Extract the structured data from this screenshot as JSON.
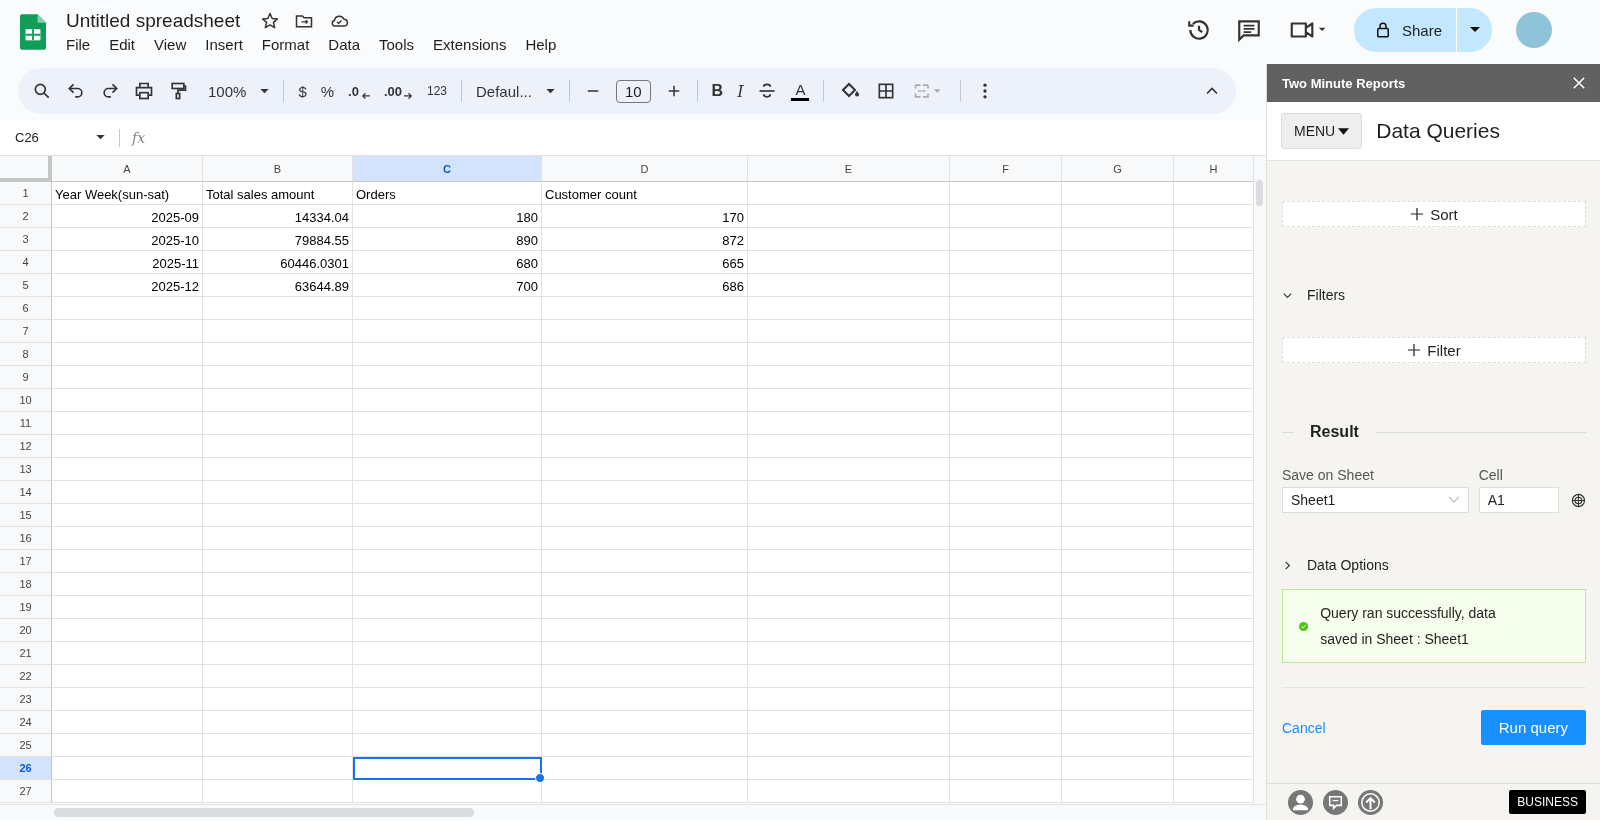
{
  "document": {
    "title": "Untitled spreadsheet"
  },
  "menu": [
    "File",
    "Edit",
    "View",
    "Insert",
    "Format",
    "Data",
    "Tools",
    "Extensions",
    "Help"
  ],
  "share_button": {
    "label": "Share"
  },
  "toolbar": {
    "zoom": "100%",
    "currency": "$",
    "percent": "%",
    "decrease_decimals": ".0",
    "increase_decimals": ".00",
    "number_format": "123",
    "font": "Defaul...",
    "font_size": "10",
    "bold": "B",
    "italic": "I",
    "text_color": "A"
  },
  "name_box": "C26",
  "formula_label": "fx",
  "sheet": {
    "columns": [
      {
        "label": "A",
        "selected": false
      },
      {
        "label": "B",
        "selected": false
      },
      {
        "label": "C",
        "selected": true
      },
      {
        "label": "D",
        "selected": false
      },
      {
        "label": "E",
        "selected": false
      },
      {
        "label": "F",
        "selected": false
      },
      {
        "label": "G",
        "selected": false
      },
      {
        "label": "H",
        "selected": false
      }
    ],
    "rows": [
      {
        "number": "1",
        "selected": false,
        "cells": [
          "Year Week(sun-sat)",
          "Total sales amount",
          "Orders",
          "Customer count"
        ]
      },
      {
        "number": "2",
        "selected": false,
        "cells": [
          "2025-09",
          "14334.04",
          "180",
          "170"
        ]
      },
      {
        "number": "3",
        "selected": false,
        "cells": [
          "2025-10",
          "79884.55",
          "890",
          "872"
        ]
      },
      {
        "number": "4",
        "selected": false,
        "cells": [
          "2025-11",
          "60446.0301",
          "680",
          "665"
        ]
      },
      {
        "number": "5",
        "selected": false,
        "cells": [
          "2025-12",
          "63644.89",
          "700",
          "686"
        ]
      },
      {
        "number": "6",
        "selected": false,
        "cells": []
      },
      {
        "number": "7",
        "selected": false,
        "cells": []
      },
      {
        "number": "8",
        "selected": false,
        "cells": []
      },
      {
        "number": "9",
        "selected": false,
        "cells": []
      },
      {
        "number": "10",
        "selected": false,
        "cells": []
      },
      {
        "number": "11",
        "selected": false,
        "cells": []
      },
      {
        "number": "12",
        "selected": false,
        "cells": []
      },
      {
        "number": "13",
        "selected": false,
        "cells": []
      },
      {
        "number": "14",
        "selected": false,
        "cells": []
      },
      {
        "number": "15",
        "selected": false,
        "cells": []
      },
      {
        "number": "16",
        "selected": false,
        "cells": []
      },
      {
        "number": "17",
        "selected": false,
        "cells": []
      },
      {
        "number": "18",
        "selected": false,
        "cells": []
      },
      {
        "number": "19",
        "selected": false,
        "cells": []
      },
      {
        "number": "20",
        "selected": false,
        "cells": []
      },
      {
        "number": "21",
        "selected": false,
        "cells": []
      },
      {
        "number": "22",
        "selected": false,
        "cells": []
      },
      {
        "number": "23",
        "selected": false,
        "cells": []
      },
      {
        "number": "24",
        "selected": false,
        "cells": []
      },
      {
        "number": "25",
        "selected": false,
        "cells": []
      },
      {
        "number": "26",
        "selected": true,
        "cells": []
      },
      {
        "number": "27",
        "selected": false,
        "cells": []
      }
    ]
  },
  "sidebar": {
    "title": "Two Minute Reports",
    "menu_button": "MENU",
    "heading": "Data Queries",
    "sort_button": "Sort",
    "filters": {
      "label": "Filters",
      "expanded": true,
      "button": "Filter"
    },
    "result": {
      "heading": "Result",
      "sheet_label": "Save on Sheet",
      "sheet_value": "Sheet1",
      "cell_label": "Cell",
      "cell_value": "A1"
    },
    "data_options": {
      "label": "Data Options",
      "expanded": false
    },
    "message": "Query ran successfully, data saved in Sheet : Sheet1",
    "cancel_button": "Cancel",
    "run_button": "Run query",
    "badge": "BUSINESS"
  }
}
